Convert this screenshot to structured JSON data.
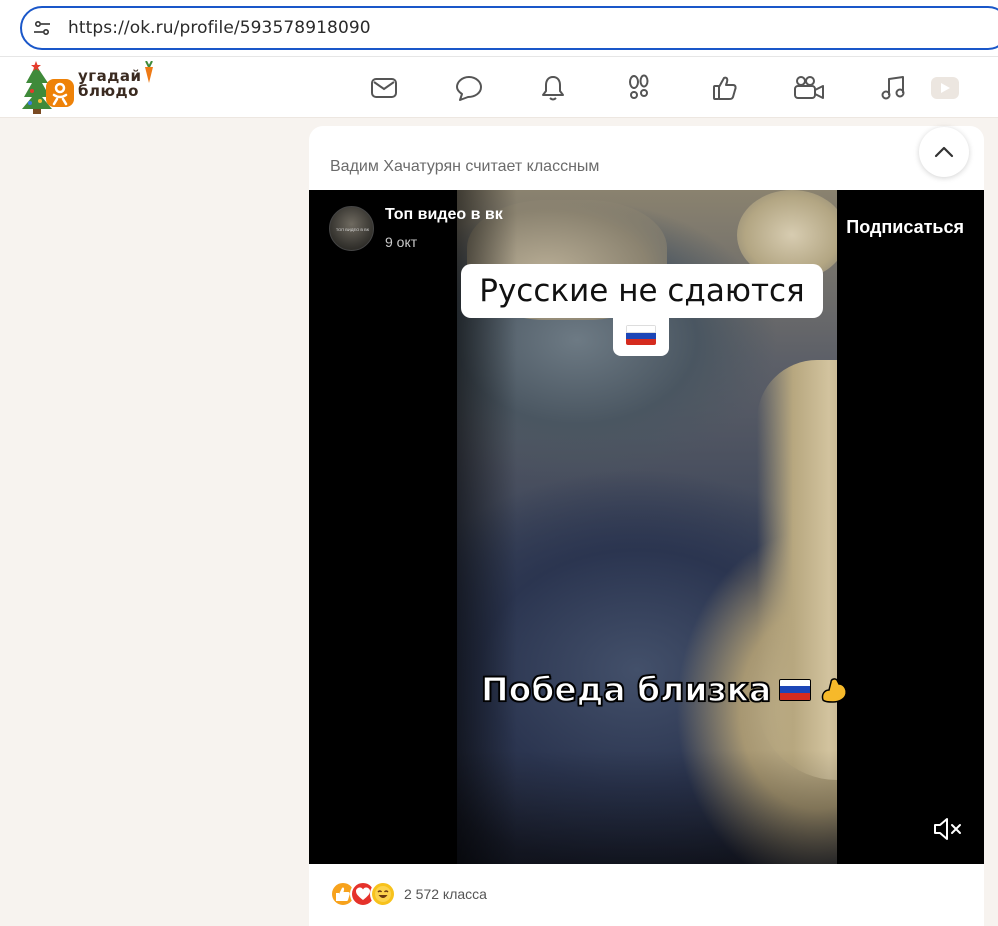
{
  "browser": {
    "url": "https://ok.ru/profile/593578918090"
  },
  "topbar": {
    "logo_text_line1": "угадай",
    "logo_text_line2": "блюдо",
    "nav_icons": [
      "mail-icon",
      "chat-icon",
      "bell-icon",
      "guests-footprints-icon",
      "likes-thumb-icon",
      "video-camera-icon",
      "music-note-icon",
      "video-play-icon"
    ]
  },
  "post": {
    "header_text": "Вадим Хачатурян считает классным",
    "channel": {
      "name": "Топ видео в вк",
      "date": "9 окт",
      "avatar_label": "ТОП ВИДЕО В ВК"
    },
    "subscribe_label": "Подписаться",
    "video": {
      "caption_top": "Русские не сдаются",
      "caption_bottom": "Победа близка"
    },
    "reactions": {
      "count_text": "2 572 класса",
      "icons": [
        "like-reaction-icon",
        "heart-reaction-icon",
        "laugh-reaction-icon"
      ]
    }
  },
  "colors": {
    "accent_blue": "#1a57c9",
    "ok_orange": "#ee8208",
    "page_bg": "#f7f3ef"
  }
}
